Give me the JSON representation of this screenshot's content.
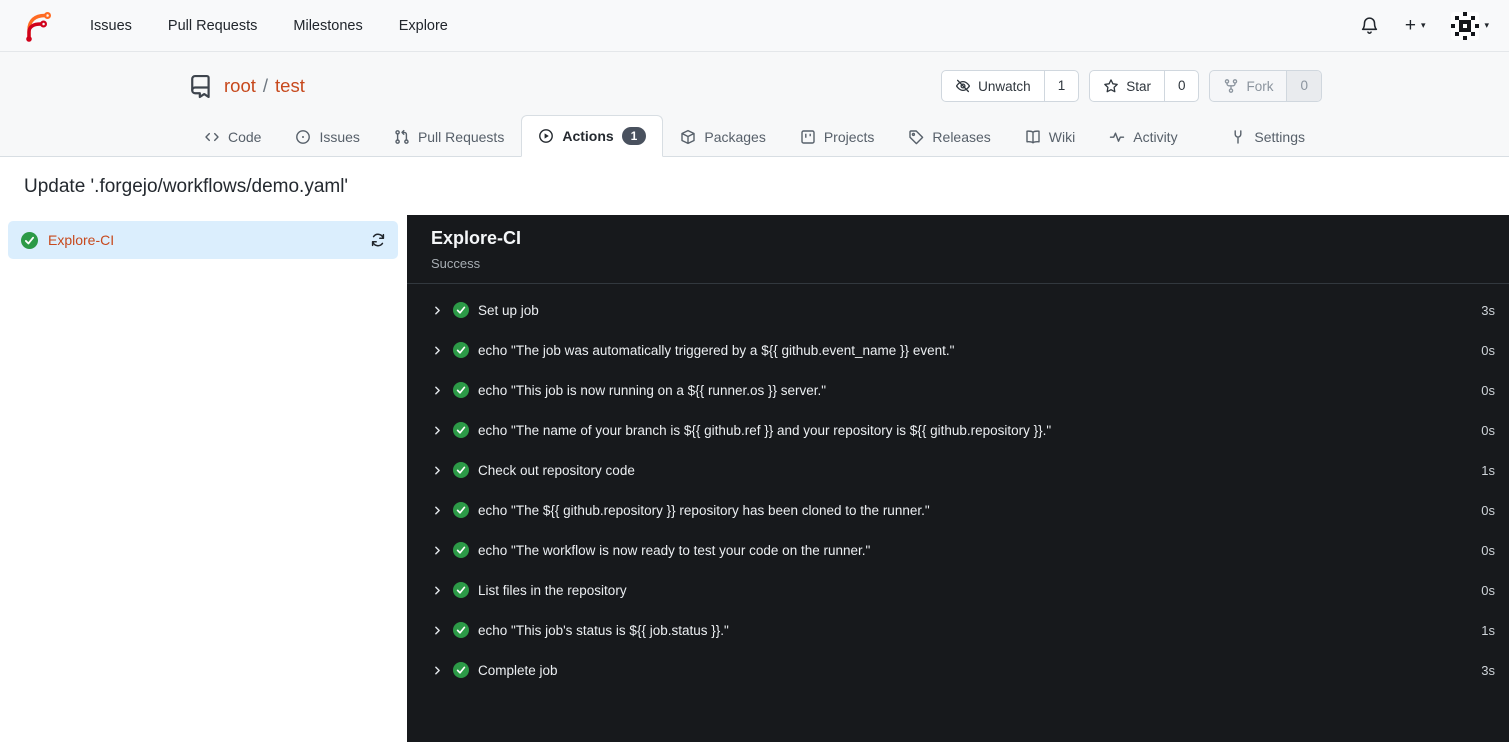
{
  "colors": {
    "primary_link": "#c7491d",
    "success_green": "#2c9a47",
    "selected_job_bg": "#dbeefd",
    "panel_bg": "#17191c",
    "tab_badge_bg": "#49515e"
  },
  "icons": {
    "forgejo-logo": "curved F glyph (orange+red)",
    "bell": "notification bell outline",
    "plus": "+",
    "caret-down": "▾",
    "avatar": "black/white pixel identicon",
    "repo": "journal/bookmark book",
    "eye-slash": "unwatch crossed eye",
    "star": "☆",
    "fork": "git fork nodes",
    "code": "<>",
    "issue": "circle with dot",
    "pull-request": "git pull request arrow",
    "play-circle": "▶ in circle",
    "package": "cube",
    "project": "board",
    "tag": "release tag",
    "book-open": "wiki book",
    "pulse": "activity line",
    "tools": "settings tools",
    "check-circle": "green circle with white check",
    "chevron-right": "›",
    "refresh": "circular sync arrows"
  },
  "navbar": {
    "items": [
      {
        "label": "Issues"
      },
      {
        "label": "Pull Requests"
      },
      {
        "label": "Milestones"
      },
      {
        "label": "Explore"
      }
    ],
    "plus_glyph": "+",
    "caret_glyph": "▾"
  },
  "repo": {
    "owner": "root",
    "separator": "/",
    "name": "test"
  },
  "repo_actions": {
    "unwatch": {
      "label": "Unwatch",
      "count": "1"
    },
    "star": {
      "label": "Star",
      "count": "0"
    },
    "fork": {
      "label": "Fork",
      "count": "0"
    }
  },
  "tabs": [
    {
      "label": "Code"
    },
    {
      "label": "Issues"
    },
    {
      "label": "Pull Requests"
    },
    {
      "label": "Actions",
      "badge": "1"
    },
    {
      "label": "Packages"
    },
    {
      "label": "Projects"
    },
    {
      "label": "Releases"
    },
    {
      "label": "Wiki"
    },
    {
      "label": "Activity"
    },
    {
      "label": "Settings"
    }
  ],
  "page": {
    "title": "Update '.forgejo/workflows/demo.yaml'"
  },
  "sidebar": {
    "job": {
      "label": "Explore-CI",
      "status": "success"
    }
  },
  "run_panel": {
    "title": "Explore-CI",
    "status": "Success",
    "steps": [
      {
        "label": "Set up job",
        "duration": "3s"
      },
      {
        "label": "echo \"The job was automatically triggered by a ${{ github.event_name }} event.\"",
        "duration": "0s"
      },
      {
        "label": "echo \"This job is now running on a ${{ runner.os }} server.\"",
        "duration": "0s"
      },
      {
        "label": "echo \"The name of your branch is ${{ github.ref }} and your repository is ${{ github.repository }}.\"",
        "duration": "0s"
      },
      {
        "label": "Check out repository code",
        "duration": "1s"
      },
      {
        "label": "echo \"The ${{ github.repository }} repository has been cloned to the runner.\"",
        "duration": "0s"
      },
      {
        "label": "echo \"The workflow is now ready to test your code on the runner.\"",
        "duration": "0s"
      },
      {
        "label": "List files in the repository",
        "duration": "0s"
      },
      {
        "label": "echo \"This job's status is ${{ job.status }}.\"",
        "duration": "1s"
      },
      {
        "label": "Complete job",
        "duration": "3s"
      }
    ]
  }
}
